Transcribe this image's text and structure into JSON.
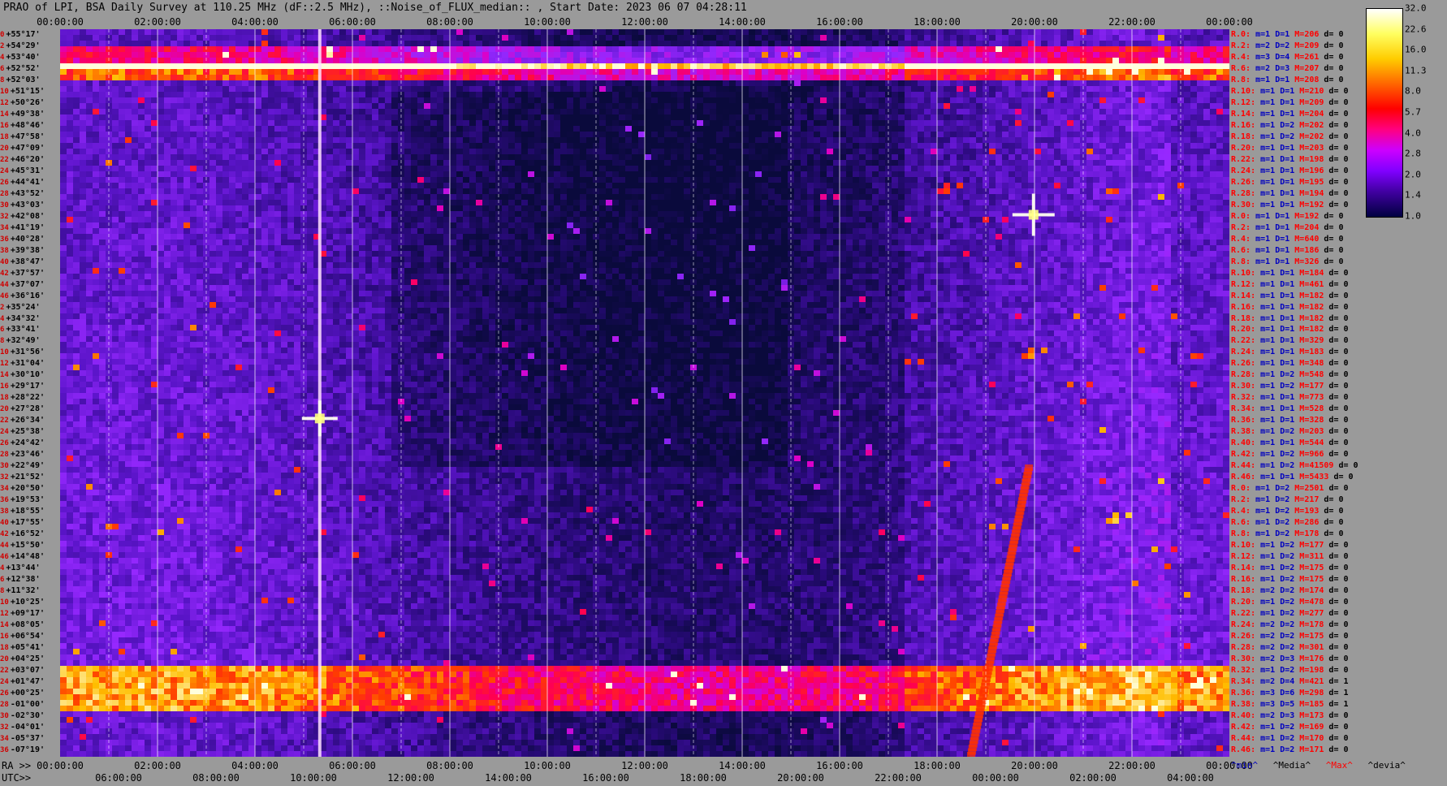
{
  "title": "PRAO of LPI, BSA Daily Survey at 110.25 MHz (dF::2.5 MHz), ::Noise_of_FLUX_median:: , Start Date: 2023 06 07 04:28:11",
  "top_axis_ticks": [
    "00:00:00",
    "02:00:00",
    "04:00:00",
    "06:00:00",
    "08:00:00",
    "10:00:00",
    "12:00:00",
    "14:00:00",
    "16:00:00",
    "18:00:00",
    "20:00:00",
    "22:00:00",
    "00:00:00"
  ],
  "ra_label": "RA >>",
  "ra_ticks": [
    "00:00:00",
    "02:00:00",
    "04:00:00",
    "06:00:00",
    "08:00:00",
    "10:00:00",
    "12:00:00",
    "14:00:00",
    "16:00:00",
    "18:00:00",
    "20:00:00",
    "22:00:00",
    "00:00:00"
  ],
  "utc_label": "UTC>>",
  "utc_ticks": [
    "06:00:00",
    "08:00:00",
    "10:00:00",
    "12:00:00",
    "14:00:00",
    "16:00:00",
    "18:00:00",
    "20:00:00",
    "22:00:00",
    "00:00:00",
    "02:00:00",
    "04:00:00"
  ],
  "legend": {
    "min": "^min^",
    "median": "^Media^",
    "max": "^Max^",
    "devia": "^devia^"
  },
  "colorbar": {
    "ticks": [
      "32.0",
      "22.6",
      "16.0",
      "11.3",
      "8.0",
      "5.7",
      "4.0",
      "2.8",
      "2.0",
      "1.4",
      "1.0"
    ]
  },
  "colors": {
    "background": "#9a9a9a",
    "label_red": "#ff0000",
    "label_blue": "#0000c0"
  },
  "dec_labels": [
    {
      "i": "0",
      "v": "+55°17'"
    },
    {
      "i": "2",
      "v": "+54°29'"
    },
    {
      "i": "4",
      "v": "+53°40'"
    },
    {
      "i": "6",
      "v": "+52°52'"
    },
    {
      "i": "8",
      "v": "+52°03'"
    },
    {
      "i": "10",
      "v": "+51°15'"
    },
    {
      "i": "12",
      "v": "+50°26'"
    },
    {
      "i": "14",
      "v": "+49°38'"
    },
    {
      "i": "16",
      "v": "+48°46'"
    },
    {
      "i": "18",
      "v": "+47°58'"
    },
    {
      "i": "20",
      "v": "+47°09'"
    },
    {
      "i": "22",
      "v": "+46°20'"
    },
    {
      "i": "24",
      "v": "+45°31'"
    },
    {
      "i": "26",
      "v": "+44°41'"
    },
    {
      "i": "28",
      "v": "+43°52'"
    },
    {
      "i": "30",
      "v": "+43°03'"
    },
    {
      "i": "32",
      "v": "+42°08'"
    },
    {
      "i": "34",
      "v": "+41°19'"
    },
    {
      "i": "36",
      "v": "+40°28'"
    },
    {
      "i": "38",
      "v": "+39°38'"
    },
    {
      "i": "40",
      "v": "+38°47'"
    },
    {
      "i": "42",
      "v": "+37°57'"
    },
    {
      "i": "44",
      "v": "+37°07'"
    },
    {
      "i": "46",
      "v": "+36°16'"
    },
    {
      "i": "2",
      "v": "+35°24'"
    },
    {
      "i": "4",
      "v": "+34°32'"
    },
    {
      "i": "6",
      "v": "+33°41'"
    },
    {
      "i": "8",
      "v": "+32°49'"
    },
    {
      "i": "10",
      "v": "+31°56'"
    },
    {
      "i": "12",
      "v": "+31°04'"
    },
    {
      "i": "14",
      "v": "+30°10'"
    },
    {
      "i": "16",
      "v": "+29°17'"
    },
    {
      "i": "18",
      "v": "+28°22'"
    },
    {
      "i": "20",
      "v": "+27°28'"
    },
    {
      "i": "22",
      "v": "+26°34'"
    },
    {
      "i": "24",
      "v": "+25°38'"
    },
    {
      "i": "26",
      "v": "+24°42'"
    },
    {
      "i": "28",
      "v": "+23°46'"
    },
    {
      "i": "30",
      "v": "+22°49'"
    },
    {
      "i": "32",
      "v": "+21°52'"
    },
    {
      "i": "34",
      "v": "+20°50'"
    },
    {
      "i": "36",
      "v": "+19°53'"
    },
    {
      "i": "38",
      "v": "+18°55'"
    },
    {
      "i": "40",
      "v": "+17°55'"
    },
    {
      "i": "42",
      "v": "+16°52'"
    },
    {
      "i": "44",
      "v": "+15°50'"
    },
    {
      "i": "46",
      "v": "+14°48'"
    },
    {
      "i": "4",
      "v": "+13°44'"
    },
    {
      "i": "6",
      "v": "+12°38'"
    },
    {
      "i": "8",
      "v": "+11°32'"
    },
    {
      "i": "10",
      "v": "+10°25'"
    },
    {
      "i": "12",
      "v": "+09°17'"
    },
    {
      "i": "14",
      "v": "+08°05'"
    },
    {
      "i": "16",
      "v": "+06°54'"
    },
    {
      "i": "18",
      "v": "+05°41'"
    },
    {
      "i": "20",
      "v": "+04°25'"
    },
    {
      "i": "22",
      "v": "+03°07'"
    },
    {
      "i": "24",
      "v": "+01°47'"
    },
    {
      "i": "26",
      "v": "+00°25'"
    },
    {
      "i": "28",
      "v": "-01°00'"
    },
    {
      "i": "30",
      "v": "-02°30'"
    },
    {
      "i": "32",
      "v": "-04°01'"
    },
    {
      "i": "34",
      "v": "-05°37'"
    },
    {
      "i": "36",
      "v": "-07°19'"
    }
  ],
  "right_stats": [
    {
      "r": "R.0:",
      "m": "m=1",
      "d": "D=1",
      "mx": "M=206",
      "dv": "d= 0"
    },
    {
      "r": "R.2:",
      "m": "m=2",
      "d": "D=2",
      "mx": "M=209",
      "dv": "d= 0"
    },
    {
      "r": "R.4:",
      "m": "m=3",
      "d": "D=4",
      "mx": "M=261",
      "dv": "d= 0"
    },
    {
      "r": "R.6:",
      "m": "m=2",
      "d": "D=3",
      "mx": "M=207",
      "dv": "d= 0"
    },
    {
      "r": "R.8:",
      "m": "m=1",
      "d": "D=1",
      "mx": "M=208",
      "dv": "d= 0"
    },
    {
      "r": "R.10:",
      "m": "m=1",
      "d": "D=1",
      "mx": "M=210",
      "dv": "d= 0"
    },
    {
      "r": "R.12:",
      "m": "m=1",
      "d": "D=1",
      "mx": "M=209",
      "dv": "d= 0"
    },
    {
      "r": "R.14:",
      "m": "m=1",
      "d": "D=1",
      "mx": "M=204",
      "dv": "d= 0"
    },
    {
      "r": "R.16:",
      "m": "m=1",
      "d": "D=2",
      "mx": "M=202",
      "dv": "d= 0"
    },
    {
      "r": "R.18:",
      "m": "m=1",
      "d": "D=2",
      "mx": "M=202",
      "dv": "d= 0"
    },
    {
      "r": "R.20:",
      "m": "m=1",
      "d": "D=1",
      "mx": "M=203",
      "dv": "d= 0"
    },
    {
      "r": "R.22:",
      "m": "m=1",
      "d": "D=1",
      "mx": "M=198",
      "dv": "d= 0"
    },
    {
      "r": "R.24:",
      "m": "m=1",
      "d": "D=1",
      "mx": "M=196",
      "dv": "d= 0"
    },
    {
      "r": "R.26:",
      "m": "m=1",
      "d": "D=1",
      "mx": "M=195",
      "dv": "d= 0"
    },
    {
      "r": "R.28:",
      "m": "m=1",
      "d": "D=1",
      "mx": "M=194",
      "dv": "d= 0"
    },
    {
      "r": "R.30:",
      "m": "m=1",
      "d": "D=1",
      "mx": "M=192",
      "dv": "d= 0"
    },
    {
      "r": "R.0:",
      "m": "m=1",
      "d": "D=1",
      "mx": "M=192",
      "dv": "d= 0"
    },
    {
      "r": "R.2:",
      "m": "m=1",
      "d": "D=1",
      "mx": "M=204",
      "dv": "d= 0"
    },
    {
      "r": "R.4:",
      "m": "m=1",
      "d": "D=1",
      "mx": "M=640",
      "dv": "d= 0"
    },
    {
      "r": "R.6:",
      "m": "m=1",
      "d": "D=1",
      "mx": "M=186",
      "dv": "d= 0"
    },
    {
      "r": "R.8:",
      "m": "m=1",
      "d": "D=1",
      "mx": "M=326",
      "dv": "d= 0"
    },
    {
      "r": "R.10:",
      "m": "m=1",
      "d": "D=1",
      "mx": "M=184",
      "dv": "d= 0"
    },
    {
      "r": "R.12:",
      "m": "m=1",
      "d": "D=1",
      "mx": "M=461",
      "dv": "d= 0"
    },
    {
      "r": "R.14:",
      "m": "m=1",
      "d": "D=1",
      "mx": "M=182",
      "dv": "d= 0"
    },
    {
      "r": "R.16:",
      "m": "m=1",
      "d": "D=1",
      "mx": "M=182",
      "dv": "d= 0"
    },
    {
      "r": "R.18:",
      "m": "m=1",
      "d": "D=1",
      "mx": "M=182",
      "dv": "d= 0"
    },
    {
      "r": "R.20:",
      "m": "m=1",
      "d": "D=1",
      "mx": "M=182",
      "dv": "d= 0"
    },
    {
      "r": "R.22:",
      "m": "m=1",
      "d": "D=1",
      "mx": "M=329",
      "dv": "d= 0"
    },
    {
      "r": "R.24:",
      "m": "m=1",
      "d": "D=1",
      "mx": "M=183",
      "dv": "d= 0"
    },
    {
      "r": "R.26:",
      "m": "m=1",
      "d": "D=1",
      "mx": "M=348",
      "dv": "d= 0"
    },
    {
      "r": "R.28:",
      "m": "m=1",
      "d": "D=2",
      "mx": "M=548",
      "dv": "d= 0"
    },
    {
      "r": "R.30:",
      "m": "m=1",
      "d": "D=2",
      "mx": "M=177",
      "dv": "d= 0"
    },
    {
      "r": "R.32:",
      "m": "m=1",
      "d": "D=1",
      "mx": "M=773",
      "dv": "d= 0"
    },
    {
      "r": "R.34:",
      "m": "m=1",
      "d": "D=1",
      "mx": "M=528",
      "dv": "d= 0"
    },
    {
      "r": "R.36:",
      "m": "m=1",
      "d": "D=1",
      "mx": "M=328",
      "dv": "d= 0"
    },
    {
      "r": "R.38:",
      "m": "m=1",
      "d": "D=2",
      "mx": "M=203",
      "dv": "d= 0"
    },
    {
      "r": "R.40:",
      "m": "m=1",
      "d": "D=1",
      "mx": "M=544",
      "dv": "d= 0"
    },
    {
      "r": "R.42:",
      "m": "m=1",
      "d": "D=2",
      "mx": "M=966",
      "dv": "d= 0"
    },
    {
      "r": "R.44:",
      "m": "m=1",
      "d": "D=2",
      "mx": "M=41509",
      "dv": "d= 0"
    },
    {
      "r": "R.46:",
      "m": "m=1",
      "d": "D=1",
      "mx": "M=5433",
      "dv": "d= 0"
    },
    {
      "r": "R.0:",
      "m": "m=1",
      "d": "D=2",
      "mx": "M=2501",
      "dv": "d= 0"
    },
    {
      "r": "R.2:",
      "m": "m=1",
      "d": "D=2",
      "mx": "M=217",
      "dv": "d= 0"
    },
    {
      "r": "R.4:",
      "m": "m=1",
      "d": "D=2",
      "mx": "M=193",
      "dv": "d= 0"
    },
    {
      "r": "R.6:",
      "m": "m=1",
      "d": "D=2",
      "mx": "M=286",
      "dv": "d= 0"
    },
    {
      "r": "R.8:",
      "m": "m=1",
      "d": "D=2",
      "mx": "M=178",
      "dv": "d= 0"
    },
    {
      "r": "R.10:",
      "m": "m=1",
      "d": "D=2",
      "mx": "M=177",
      "dv": "d= 0"
    },
    {
      "r": "R.12:",
      "m": "m=1",
      "d": "D=2",
      "mx": "M=311",
      "dv": "d= 0"
    },
    {
      "r": "R.14:",
      "m": "m=1",
      "d": "D=2",
      "mx": "M=175",
      "dv": "d= 0"
    },
    {
      "r": "R.16:",
      "m": "m=1",
      "d": "D=2",
      "mx": "M=175",
      "dv": "d= 0"
    },
    {
      "r": "R.18:",
      "m": "m=2",
      "d": "D=2",
      "mx": "M=174",
      "dv": "d= 0"
    },
    {
      "r": "R.20:",
      "m": "m=1",
      "d": "D=2",
      "mx": "M=478",
      "dv": "d= 0"
    },
    {
      "r": "R.22:",
      "m": "m=1",
      "d": "D=2",
      "mx": "M=277",
      "dv": "d= 0"
    },
    {
      "r": "R.24:",
      "m": "m=2",
      "d": "D=2",
      "mx": "M=178",
      "dv": "d= 0"
    },
    {
      "r": "R.26:",
      "m": "m=2",
      "d": "D=2",
      "mx": "M=175",
      "dv": "d= 0"
    },
    {
      "r": "R.28:",
      "m": "m=2",
      "d": "D=2",
      "mx": "M=301",
      "dv": "d= 0"
    },
    {
      "r": "R.30:",
      "m": "m=2",
      "d": "D=3",
      "mx": "M=176",
      "dv": "d= 0"
    },
    {
      "r": "R.32:",
      "m": "m=1",
      "d": "D=2",
      "mx": "M=198",
      "dv": "d= 0"
    },
    {
      "r": "R.34:",
      "m": "m=2",
      "d": "D=4",
      "mx": "M=421",
      "dv": "d= 1"
    },
    {
      "r": "R.36:",
      "m": "m=3",
      "d": "D=6",
      "mx": "M=298",
      "dv": "d= 1"
    },
    {
      "r": "R.38:",
      "m": "m=3",
      "d": "D=5",
      "mx": "M=185",
      "dv": "d= 1"
    },
    {
      "r": "R.40:",
      "m": "m=2",
      "d": "D=3",
      "mx": "M=173",
      "dv": "d= 0"
    },
    {
      "r": "R.42:",
      "m": "m=1",
      "d": "D=2",
      "mx": "M=169",
      "dv": "d= 0"
    },
    {
      "r": "R.44:",
      "m": "m=1",
      "d": "D=2",
      "mx": "M=170",
      "dv": "d= 0"
    },
    {
      "r": "R.46:",
      "m": "m=1",
      "d": "D=2",
      "mx": "M=171",
      "dv": "d= 0"
    }
  ],
  "chart_data": {
    "type": "heatmap",
    "title": "PRAO of LPI, BSA Daily Survey at 110.25 MHz (dF::2.5 MHz), ::Noise_of_FLUX_median:: , Start Date: 2023 06 07 04:28:11",
    "x_axis_label": "RA",
    "x_ticks_ra": [
      "00:00:00",
      "02:00:00",
      "04:00:00",
      "06:00:00",
      "08:00:00",
      "10:00:00",
      "12:00:00",
      "14:00:00",
      "16:00:00",
      "18:00:00",
      "20:00:00",
      "22:00:00",
      "00:00:00"
    ],
    "x_ticks_utc": [
      "06:00:00",
      "08:00:00",
      "10:00:00",
      "12:00:00",
      "14:00:00",
      "16:00:00",
      "18:00:00",
      "20:00:00",
      "22:00:00",
      "00:00:00",
      "02:00:00",
      "04:00:00"
    ],
    "y_range_dec": [
      "+55°17'",
      "-07°19'"
    ],
    "color_scale": [
      1.0,
      1.4,
      2.0,
      2.8,
      4.0,
      5.7,
      8.0,
      11.3,
      16.0,
      22.6,
      32.0
    ],
    "features": [
      {
        "kind": "bright-horizontal-band",
        "dec": "+53°40'"
      },
      {
        "kind": "bright-horizontal-band",
        "dec": "+00°25'"
      },
      {
        "kind": "bright-vertical-line",
        "ra": "05:20:00"
      },
      {
        "kind": "bright-source",
        "ra": "05:20:00",
        "dec": "+22°49'"
      },
      {
        "kind": "bright-source",
        "ra": "19:59:00",
        "dec": "+40°28'"
      },
      {
        "kind": "diagonal-streak",
        "ra_start": "18:40:00",
        "ra_end": "20:00:00"
      }
    ]
  }
}
